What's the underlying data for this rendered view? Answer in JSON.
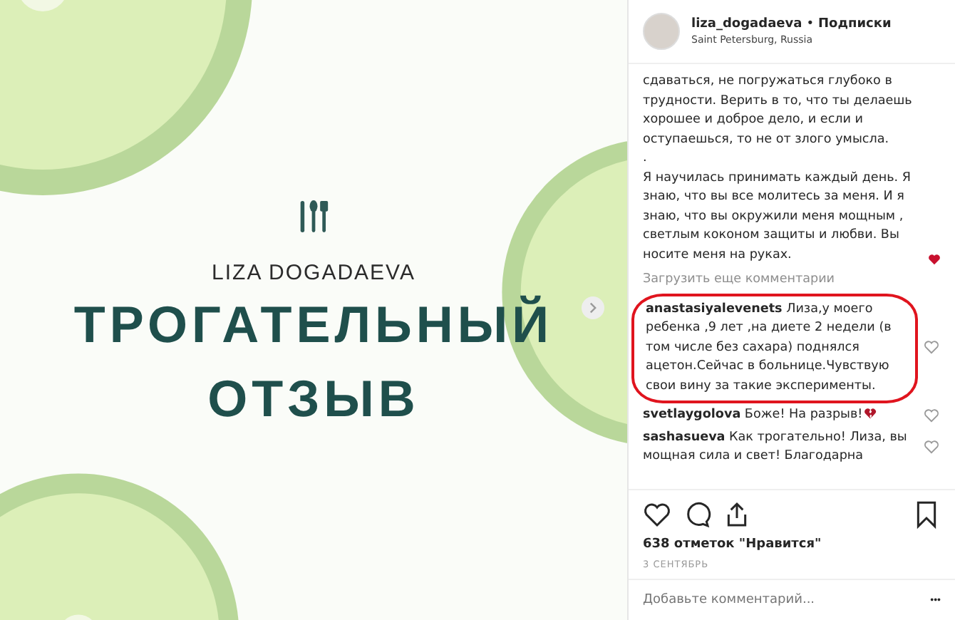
{
  "post_image": {
    "brand": "LIZA DOGADAEVA",
    "headline": [
      "ТРОГАТЕЛЬНЫЙ",
      "ОТЗЫВ"
    ]
  },
  "header": {
    "username": "liza_dogadaeva",
    "separator": "•",
    "follow": "Подписки",
    "location": "Saint Petersburg, Russia"
  },
  "caption": [
    "сдаваться, не погружаться глубоко в трудности. Верить в то, что ты делаешь хорошее и доброе дело, и если и оступаешься, то не от злого умысла.",
    ".",
    "Я научилась принимать каждый день. Я знаю, что вы все молитесь за меня. И я знаю, что вы окружили меня мощным , светлым коконом защиты и любви. Вы носите меня на руках."
  ],
  "load_more": "Загрузить еще комментарии",
  "comments": [
    {
      "user": "anastasiyalevenets",
      "text": "Лиза,у моего ребенка ,9 лет ,на диете 2 недели (в том числе без сахара) поднялся ацетон.Сейчас в больнице.Чувствую свои вину за такие эксперименты.",
      "highlighted": true,
      "broken_heart": false
    },
    {
      "user": "svetlaygolova",
      "text": "Боже! На разрыв!",
      "highlighted": false,
      "broken_heart": true
    },
    {
      "user": "sashasueva",
      "text": "Как трогательно! Лиза, вы мощная сила и свет! Благодарна",
      "highlighted": false,
      "broken_heart": false
    }
  ],
  "likes": "638 отметок \"Нравится\"",
  "date": "3 СЕНТЯБРЬ",
  "add_comment": {
    "placeholder": "Добавьте комментарий..."
  },
  "more": "•••"
}
